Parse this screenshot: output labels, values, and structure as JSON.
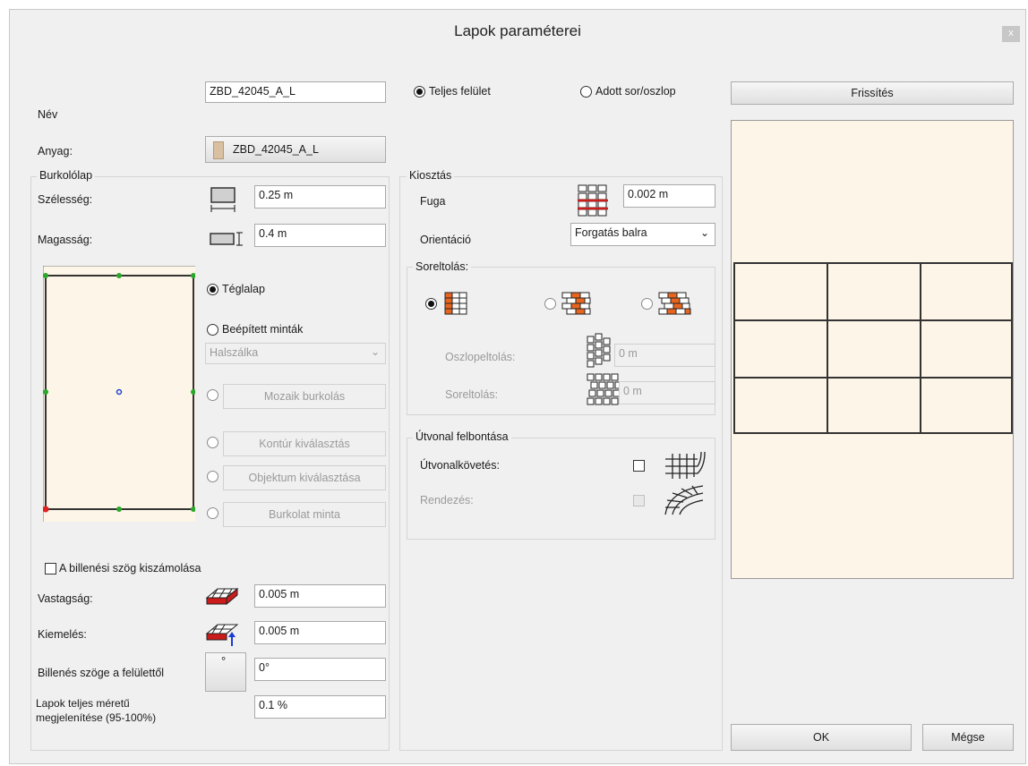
{
  "window": {
    "title": "Lapok paraméterei",
    "close_label": "x"
  },
  "name_row": {
    "label": "Név",
    "value": "ZBD_42045_A_L"
  },
  "fill_mode": {
    "full_surface": "Teljes felület",
    "given_row_col": "Adott sor/oszlop",
    "selected": "full_surface"
  },
  "refresh_button": "Frissítés",
  "material": {
    "label": "Anyag:",
    "value": "ZBD_42045_A_L"
  },
  "tile_group": {
    "title": "Burkolólap",
    "width_label": "Szélesség:",
    "width_value": "0.25 m",
    "height_label": "Magasság:",
    "height_value": "0.4 m",
    "shape_rectangle": "Téglalap",
    "builtin_patterns": "Beépített minták",
    "pattern_select": "Halszálka",
    "mosaic_button": "Mozaik burkolás",
    "contour_button": "Kontúr kiválasztás",
    "object_button": "Objektum kiválasztása",
    "cover_pattern_button": "Burkolat minta",
    "tilt_checkbox": "A billenési szög kiszámolása",
    "thickness_label": "Vastagság:",
    "thickness_value": "0.005 m",
    "offset_label": "Kiemelés:",
    "offset_value": "0.005 m",
    "tilt_angle_label": "Billenés szöge a felülettől",
    "tilt_angle_value": "0°",
    "full_size_label_1": "Lapok teljes méretű",
    "full_size_label_2": "megjelenítése (95-100%)",
    "full_size_value": "0.1 %"
  },
  "layout_group": {
    "title": "Kiosztás",
    "joint_label": "Fuga",
    "joint_value": "0.002 m",
    "orientation_label": "Orientáció",
    "orientation_value": "Forgatás balra",
    "row_offset_group": "Soreltolás:",
    "col_offset_label": "Oszlopeltolás:",
    "col_offset_value": "0 m",
    "row_offset_label": "Soreltolás:",
    "row_offset_value": "0 m"
  },
  "path_group": {
    "title": "Útvonal felbontása",
    "follow_label": "Útvonalkövetés:",
    "arrange_label": "Rendezés:"
  },
  "ok_button": "OK",
  "cancel_button": "Mégse",
  "colors": {
    "tile_fill": "#fdf5e7",
    "brick_orange": "#e8651f",
    "brick_red": "#cc1b1b"
  }
}
